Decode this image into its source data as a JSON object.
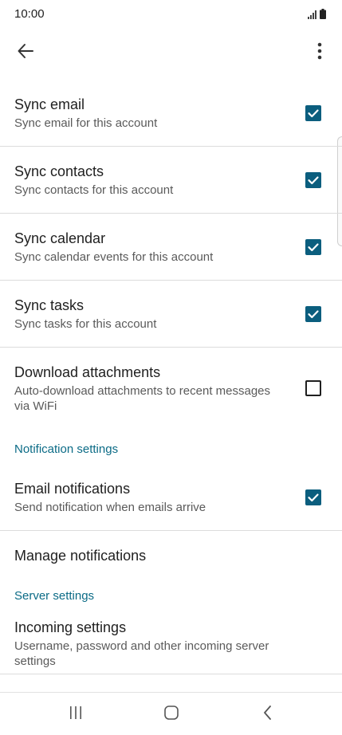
{
  "status_bar": {
    "time": "10:00",
    "icons": [
      "signal-icon",
      "battery-icon"
    ]
  },
  "app_bar": {
    "back_icon": "arrow-back-icon",
    "more_icon": "more-vert-icon"
  },
  "colors": {
    "accent": "#0b5e7e",
    "section_header": "#0b6b86",
    "divider": "#dcdcdc"
  },
  "sync": {
    "email": {
      "title": "Sync email",
      "summary": "Sync email for this account",
      "checked": true
    },
    "contacts": {
      "title": "Sync contacts",
      "summary": "Sync contacts for this account",
      "checked": true
    },
    "calendar": {
      "title": "Sync calendar",
      "summary": "Sync calendar events for this account",
      "checked": true
    },
    "tasks": {
      "title": "Sync tasks",
      "summary": "Sync tasks for this account",
      "checked": true
    },
    "attachments": {
      "title": "Download attachments",
      "summary": "Auto-download attachments to recent messages via WiFi",
      "checked": false
    }
  },
  "notification_settings": {
    "header": "Notification settings",
    "email_notifications": {
      "title": "Email notifications",
      "summary": "Send notification when emails arrive",
      "checked": true
    },
    "manage_notifications": {
      "title": "Manage notifications"
    }
  },
  "server_settings": {
    "header": "Server settings",
    "incoming": {
      "title": "Incoming settings",
      "summary": "Username, password and other incoming server settings"
    }
  },
  "nav_bar": {
    "icons": [
      "recent-apps-icon",
      "home-icon",
      "back-nav-icon"
    ]
  }
}
